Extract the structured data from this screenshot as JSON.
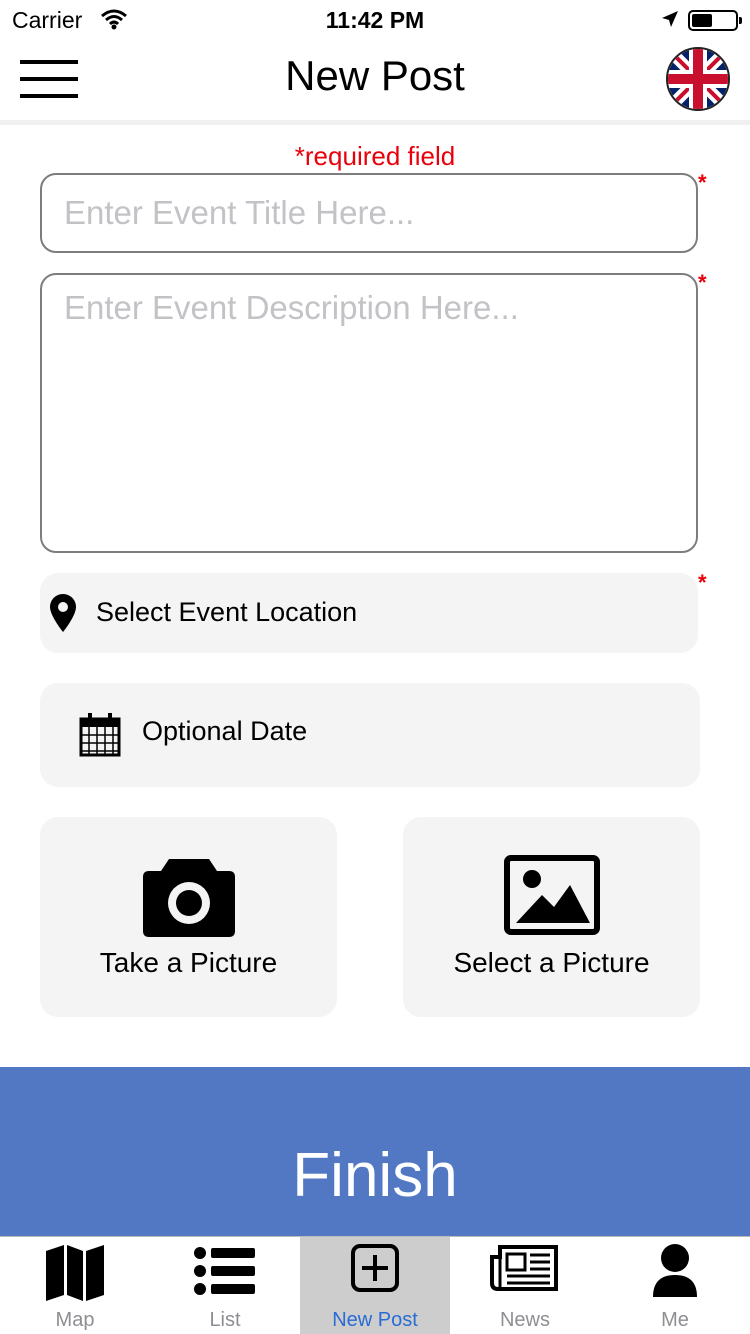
{
  "status_bar": {
    "carrier": "Carrier",
    "time": "11:42 PM",
    "wifi_icon": "wifi-icon",
    "location_icon": "location-arrow-icon",
    "battery_icon": "battery-icon",
    "battery_level": 0.45
  },
  "nav": {
    "title": "New Post",
    "menu_icon": "hamburger-menu-icon",
    "language_icon": "uk-flag-icon"
  },
  "form": {
    "required_note": "*required field",
    "required_marker": "*",
    "title_placeholder": "Enter Event Title Here...",
    "title_value": "",
    "description_placeholder": "Enter Event Description Here...",
    "description_value": "",
    "location_label": "Select Event Location",
    "location_icon": "map-pin-icon",
    "date_label": "Optional Date",
    "date_icon": "calendar-icon",
    "take_picture_label": "Take a Picture",
    "take_picture_icon": "camera-icon",
    "select_picture_label": "Select a Picture",
    "select_picture_icon": "image-icon",
    "finish_label": "Finish"
  },
  "tabs": [
    {
      "label": "Map",
      "icon": "map-icon",
      "active": false
    },
    {
      "label": "List",
      "icon": "list-icon",
      "active": false
    },
    {
      "label": "New Post",
      "icon": "plus-square-icon",
      "active": true
    },
    {
      "label": "News",
      "icon": "newspaper-icon",
      "active": false
    },
    {
      "label": "Me",
      "icon": "user-icon",
      "active": false
    }
  ],
  "colors": {
    "accent": "#5278c3",
    "required": "#e8000b",
    "active_tab_text": "#2a6cd5",
    "active_tab_bg": "#cdcdcd",
    "field_bg": "#f4f4f4"
  }
}
